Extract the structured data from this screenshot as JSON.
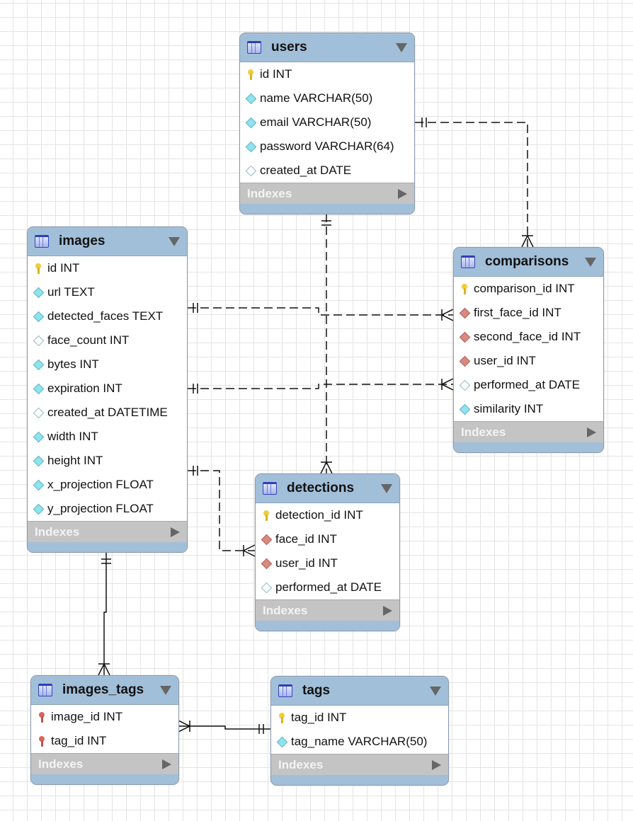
{
  "tables": {
    "users": {
      "name": "users",
      "indexes_label": "Indexes",
      "columns": [
        {
          "text": "id INT",
          "icon": "primary-key"
        },
        {
          "text": "name VARCHAR(50)",
          "icon": "not-null-column"
        },
        {
          "text": "email VARCHAR(50)",
          "icon": "not-null-column"
        },
        {
          "text": "password VARCHAR(64)",
          "icon": "not-null-column"
        },
        {
          "text": "created_at DATE",
          "icon": "nullable-column"
        }
      ]
    },
    "images": {
      "name": "images",
      "indexes_label": "Indexes",
      "columns": [
        {
          "text": "id INT",
          "icon": "primary-key"
        },
        {
          "text": "url TEXT",
          "icon": "not-null-column"
        },
        {
          "text": "detected_faces TEXT",
          "icon": "not-null-column"
        },
        {
          "text": "face_count INT",
          "icon": "nullable-column"
        },
        {
          "text": "bytes INT",
          "icon": "not-null-column"
        },
        {
          "text": "expiration INT",
          "icon": "not-null-column"
        },
        {
          "text": "created_at DATETIME",
          "icon": "nullable-column"
        },
        {
          "text": "width INT",
          "icon": "not-null-column"
        },
        {
          "text": "height INT",
          "icon": "not-null-column"
        },
        {
          "text": "x_projection FLOAT",
          "icon": "not-null-column"
        },
        {
          "text": "y_projection FLOAT",
          "icon": "not-null-column"
        }
      ]
    },
    "comparisons": {
      "name": "comparisons",
      "indexes_label": "Indexes",
      "columns": [
        {
          "text": "comparison_id INT",
          "icon": "primary-key"
        },
        {
          "text": "first_face_id INT",
          "icon": "foreign-key-column"
        },
        {
          "text": "second_face_id INT",
          "icon": "foreign-key-column"
        },
        {
          "text": "user_id INT",
          "icon": "foreign-key-column"
        },
        {
          "text": "performed_at DATE",
          "icon": "nullable-column"
        },
        {
          "text": "similarity INT",
          "icon": "not-null-column"
        }
      ]
    },
    "detections": {
      "name": "detections",
      "indexes_label": "Indexes",
      "columns": [
        {
          "text": "detection_id INT",
          "icon": "primary-key"
        },
        {
          "text": "face_id INT",
          "icon": "foreign-key-column"
        },
        {
          "text": "user_id INT",
          "icon": "foreign-key-column"
        },
        {
          "text": "performed_at DATE",
          "icon": "nullable-column"
        }
      ]
    },
    "images_tags": {
      "name": "images_tags",
      "indexes_label": "Indexes",
      "columns": [
        {
          "text": "image_id INT",
          "icon": "primary-foreign-key"
        },
        {
          "text": "tag_id INT",
          "icon": "primary-foreign-key"
        }
      ]
    },
    "tags": {
      "name": "tags",
      "indexes_label": "Indexes",
      "columns": [
        {
          "text": "tag_id INT",
          "icon": "primary-key"
        },
        {
          "text": "tag_name VARCHAR(50)",
          "icon": "not-null-column"
        }
      ]
    }
  },
  "relationships": [
    {
      "from": "users",
      "to": "comparisons",
      "type": "one-to-many",
      "style": "dashed"
    },
    {
      "from": "users",
      "to": "detections",
      "type": "one-to-many",
      "style": "dashed"
    },
    {
      "from": "images",
      "to": "comparisons",
      "type": "one-to-many",
      "style": "dashed"
    },
    {
      "from": "images",
      "to": "comparisons",
      "type": "one-to-many",
      "style": "dashed"
    },
    {
      "from": "images",
      "to": "detections",
      "type": "one-to-many",
      "style": "dashed"
    },
    {
      "from": "images",
      "to": "images_tags",
      "type": "one-to-many",
      "style": "solid"
    },
    {
      "from": "tags",
      "to": "images_tags",
      "type": "one-to-many",
      "style": "solid"
    }
  ],
  "colors": {
    "header": "#a2bfd9",
    "indexes": "#c4c4c4",
    "primary_key": "#f3cc3a",
    "foreign_key": "#d88a80",
    "column": "#8fe3ee"
  }
}
